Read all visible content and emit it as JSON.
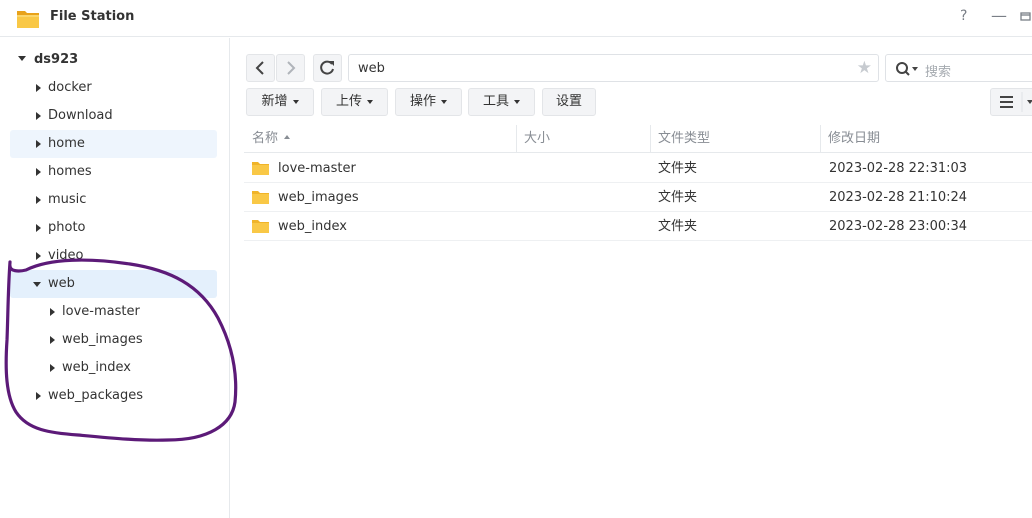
{
  "window": {
    "title": "File Station",
    "help_label": "?",
    "minimize_label": "—"
  },
  "sidebar": {
    "root": "ds923",
    "items": [
      {
        "label": "docker",
        "expanded": false
      },
      {
        "label": "Download",
        "expanded": false
      },
      {
        "label": "home",
        "expanded": false
      },
      {
        "label": "homes",
        "expanded": false
      },
      {
        "label": "music",
        "expanded": false
      },
      {
        "label": "photo",
        "expanded": false
      },
      {
        "label": "video",
        "expanded": false
      },
      {
        "label": "web",
        "expanded": true
      },
      {
        "label": "love-master",
        "expanded": false
      },
      {
        "label": "web_images",
        "expanded": false
      },
      {
        "label": "web_index",
        "expanded": false
      },
      {
        "label": "web_packages",
        "expanded": false
      }
    ]
  },
  "toolbar": {
    "path": "web",
    "search_placeholder": "搜索",
    "actions": [
      {
        "label": "新增"
      },
      {
        "label": "上传"
      },
      {
        "label": "操作"
      },
      {
        "label": "工具"
      },
      {
        "label": "设置"
      }
    ]
  },
  "file_list": {
    "columns": [
      "名称",
      "大小",
      "文件类型",
      "修改日期"
    ],
    "rows": [
      {
        "name": "love-master",
        "size": "",
        "type": "文件夹",
        "modified": "2023-02-28 22:31:03"
      },
      {
        "name": "web_images",
        "size": "",
        "type": "文件夹",
        "modified": "2023-02-28 21:10:24"
      },
      {
        "name": "web_index",
        "size": "",
        "type": "文件夹",
        "modified": "2023-02-28 23:00:34"
      }
    ]
  },
  "colors": {
    "folder": "#f9c846",
    "annotation": "#5c1a78",
    "selected": "#e4f0fc"
  }
}
